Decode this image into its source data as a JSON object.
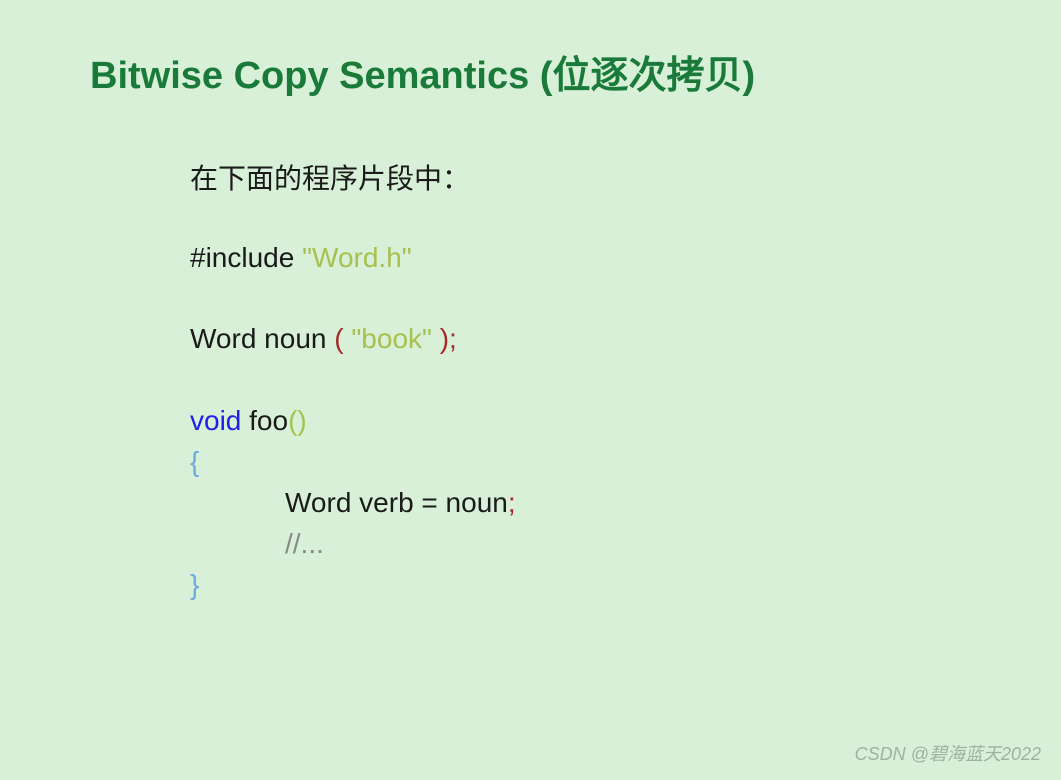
{
  "title": "Bitwise Copy Semantics (位逐次拷贝)",
  "intro": "在下面的程序片段中：",
  "code": {
    "l1a": "#include ",
    "l1b": "\"Word.h\"",
    "l2a": "Word noun ",
    "l2b": "( ",
    "l2c": "\"book\" ",
    "l2d": ");",
    "l3a": "void",
    "l3b": " foo",
    "l3c": "()",
    "l4": "{",
    "l5a": "Word verb = noun",
    "l5b": ";",
    "l6": "//...",
    "l7": "}"
  },
  "watermark": "CSDN @碧海蓝天2022"
}
